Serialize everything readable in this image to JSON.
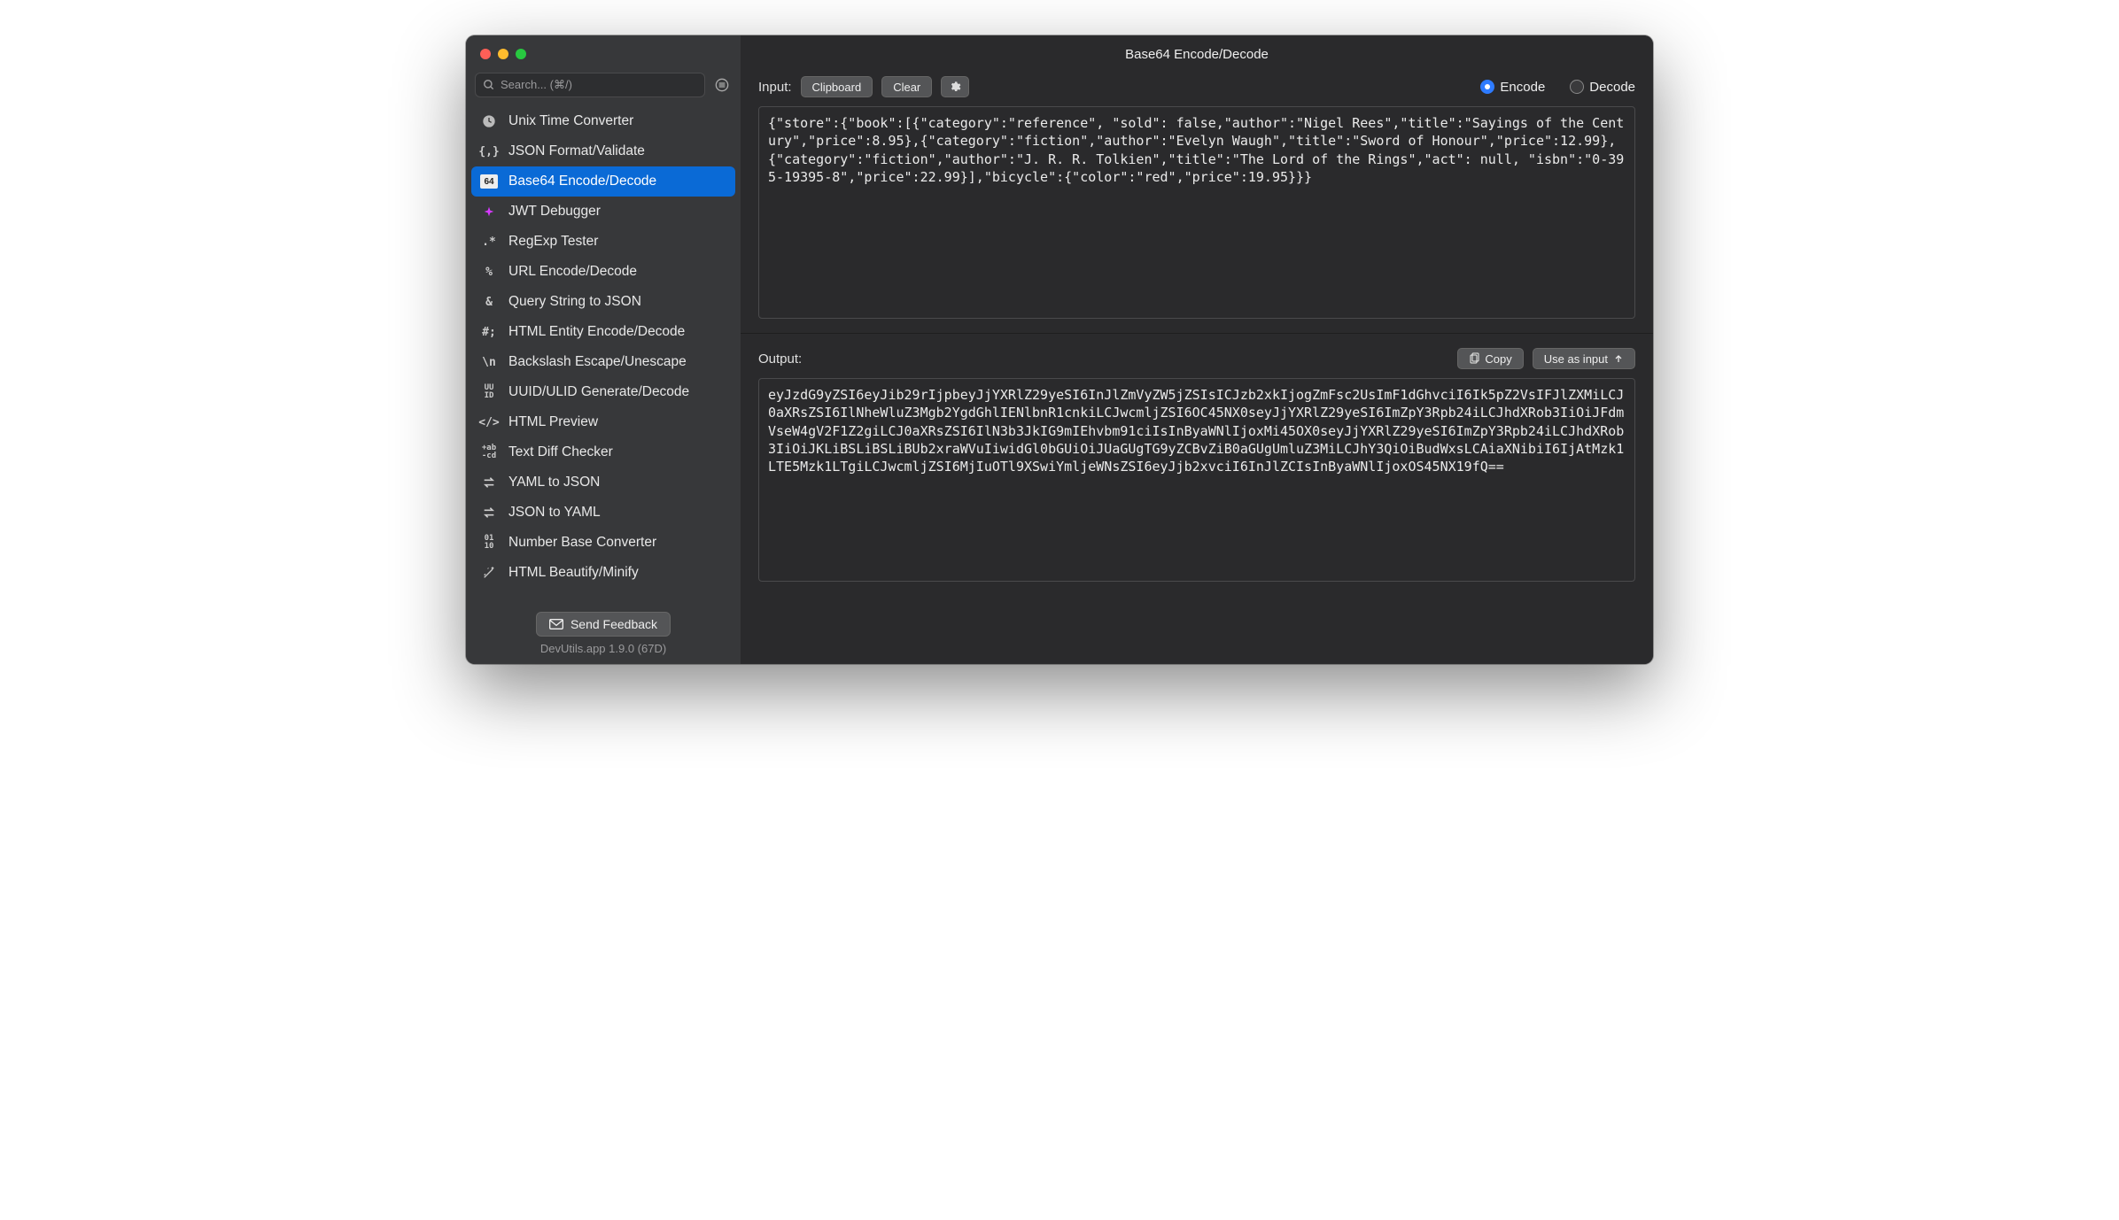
{
  "window_title": "Base64 Encode/Decode",
  "search_placeholder": "Search... (⌘/)",
  "sidebar": {
    "items": [
      {
        "label": "Unix Time Converter",
        "icon": "clock"
      },
      {
        "label": "JSON Format/Validate",
        "icon": "braces"
      },
      {
        "label": "Base64 Encode/Decode",
        "icon": "b64",
        "selected": true
      },
      {
        "label": "JWT Debugger",
        "icon": "jwt"
      },
      {
        "label": "RegExp Tester",
        "icon": "regex"
      },
      {
        "label": "URL Encode/Decode",
        "icon": "percent"
      },
      {
        "label": "Query String to JSON",
        "icon": "amp"
      },
      {
        "label": "HTML Entity Encode/Decode",
        "icon": "hash"
      },
      {
        "label": "Backslash Escape/Unescape",
        "icon": "backslash"
      },
      {
        "label": "UUID/ULID Generate/Decode",
        "icon": "uuid"
      },
      {
        "label": "HTML Preview",
        "icon": "code"
      },
      {
        "label": "Text Diff Checker",
        "icon": "diff"
      },
      {
        "label": "YAML to JSON",
        "icon": "swap"
      },
      {
        "label": "JSON to YAML",
        "icon": "swap"
      },
      {
        "label": "Number Base Converter",
        "icon": "bin"
      },
      {
        "label": "HTML Beautify/Minify",
        "icon": "wand"
      }
    ]
  },
  "footer": {
    "feedback_label": "Send Feedback",
    "version": "DevUtils.app 1.9.0 (67D)"
  },
  "toolbar": {
    "input_label": "Input:",
    "clipboard_label": "Clipboard",
    "clear_label": "Clear",
    "encode_label": "Encode",
    "decode_label": "Decode",
    "mode": "Encode",
    "output_label": "Output:",
    "copy_label": "Copy",
    "use_as_input_label": "Use as input"
  },
  "input_text": "{\"store\":{\"book\":[{\"category\":\"reference\", \"sold\": false,\"author\":\"Nigel Rees\",\"title\":\"Sayings of the Century\",\"price\":8.95},{\"category\":\"fiction\",\"author\":\"Evelyn Waugh\",\"title\":\"Sword of Honour\",\"price\":12.99},{\"category\":\"fiction\",\"author\":\"J. R. R. Tolkien\",\"title\":\"The Lord of the Rings\",\"act\": null, \"isbn\":\"0-395-19395-8\",\"price\":22.99}],\"bicycle\":{\"color\":\"red\",\"price\":19.95}}}",
  "output_text": "eyJzdG9yZSI6eyJib29rIjpbeyJjYXRlZ29yeSI6InJlZmVyZW5jZSIsICJzb2xkIjogZmFsc2UsImF1dGhvciI6Ik5pZ2VsIFJlZXMiLCJ0aXRsZSI6IlNheWluZ3Mgb2YgdGhlIENlbnR1cnkiLCJwcmljZSI6OC45NX0seyJjYXRlZ29yeSI6ImZpY3Rpb24iLCJhdXRob3IiOiJFdmVseW4gV2F1Z2giLCJ0aXRsZSI6IlN3b3JkIG9mIEhvbm91ciIsInByaWNlIjoxMi45OX0seyJjYXRlZ29yeSI6ImZpY3Rpb24iLCJhdXRob3IiOiJKLiBSLiBSLiBUb2xraWVuIiwidGl0bGUiOiJUaGUgTG9yZCBvZiB0aGUgUmluZ3MiLCJhY3QiOiBudWxsLCAiaXNibiI6IjAtMzk1LTE5Mzk1LTgiLCJwcmljZSI6MjIuOTl9XSwiYmljeWNsZSI6eyJjb2xvciI6InJlZCIsInByaWNlIjoxOS45NX19fQ=="
}
